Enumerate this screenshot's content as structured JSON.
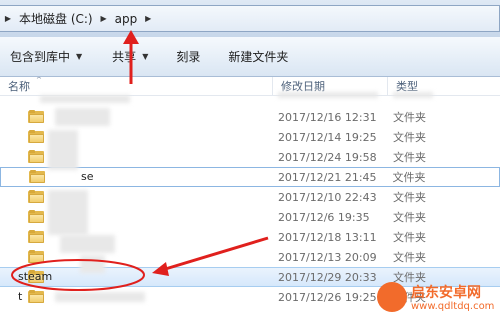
{
  "address": {
    "drive": "本地磁盘 (C:)",
    "folder": "app"
  },
  "toolbar": {
    "include_label": "包含到库中",
    "share_label": "共享",
    "burn_label": "刻录",
    "new_folder_label": "新建文件夹"
  },
  "columns": {
    "name": "名称",
    "date": "修改日期",
    "type": "类型"
  },
  "rows": [
    {
      "name": "",
      "date": "2017/12/16 12:31",
      "type": "文件夹"
    },
    {
      "name": "",
      "date": "2017/12/14 19:25",
      "type": "文件夹"
    },
    {
      "name": "",
      "date": "2017/12/24 19:58",
      "type": "文件夹"
    },
    {
      "name": "se",
      "date": "2017/12/21 21:45",
      "type": "文件夹"
    },
    {
      "name": "",
      "date": "2017/12/10 22:43",
      "type": "文件夹"
    },
    {
      "name": "",
      "date": "2017/12/6 19:35",
      "type": "文件夹"
    },
    {
      "name": "",
      "date": "2017/12/18 13:11",
      "type": "文件夹"
    },
    {
      "name": "",
      "date": "2017/12/13 20:09",
      "type": "文件夹"
    },
    {
      "name": "steam",
      "date": "2017/12/29 20:33",
      "type": "文件夹"
    },
    {
      "name": "t",
      "date": "2017/12/26 19:25",
      "type": "文件夹"
    }
  ],
  "colors": {
    "annotation": "#e0201d",
    "folder": "#f1cd6d",
    "highlight": "#d6e8fb"
  },
  "watermark": {
    "brand": "启东安卓网",
    "url": "www.qdltdq.com"
  }
}
